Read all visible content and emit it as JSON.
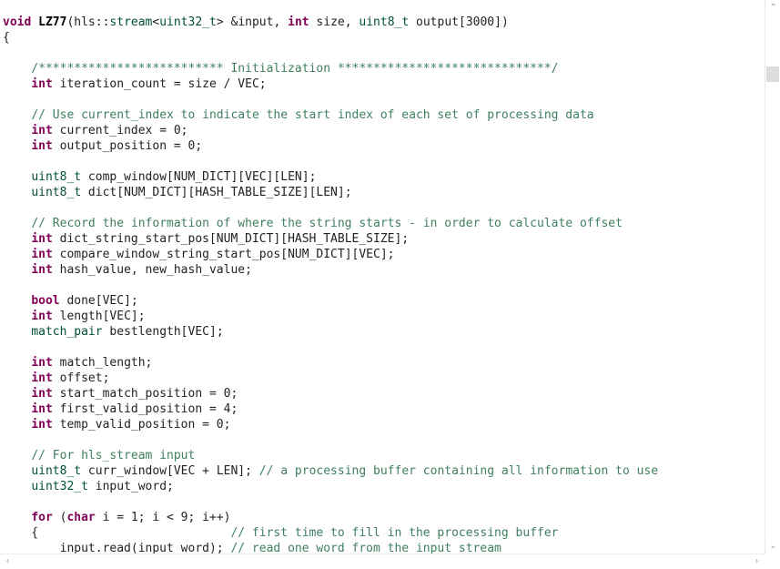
{
  "editor": {
    "lines": [
      [
        {
          "t": "void",
          "c": "kw"
        },
        {
          "t": " "
        },
        {
          "t": "LZ77",
          "c": "fn"
        },
        {
          "t": "(hls::"
        },
        {
          "t": "stream",
          "c": "ty"
        },
        {
          "t": "<"
        },
        {
          "t": "uint32_t",
          "c": "ty"
        },
        {
          "t": "> &input, "
        },
        {
          "t": "int",
          "c": "kw"
        },
        {
          "t": " size, "
        },
        {
          "t": "uint8_t",
          "c": "ty"
        },
        {
          "t": " output[3000])"
        }
      ],
      [
        {
          "t": "{"
        }
      ],
      [],
      [
        {
          "t": "    "
        },
        {
          "t": "/************************** Initialization ******************************/",
          "c": "cm"
        }
      ],
      [
        {
          "t": "    "
        },
        {
          "t": "int",
          "c": "kw"
        },
        {
          "t": " iteration_count = size / VEC;"
        }
      ],
      [],
      [
        {
          "t": "    "
        },
        {
          "t": "// Use current_index to indicate the start index of each set of processing data",
          "c": "cm"
        }
      ],
      [
        {
          "t": "    "
        },
        {
          "t": "int",
          "c": "kw"
        },
        {
          "t": " current_index = 0;"
        }
      ],
      [
        {
          "t": "    "
        },
        {
          "t": "int",
          "c": "kw"
        },
        {
          "t": " output_position = 0;"
        }
      ],
      [],
      [
        {
          "t": "    "
        },
        {
          "t": "uint8_t",
          "c": "ty"
        },
        {
          "t": " comp_window[NUM_DICT][VEC][LEN];"
        }
      ],
      [
        {
          "t": "    "
        },
        {
          "t": "uint8_t",
          "c": "ty"
        },
        {
          "t": " dict[NUM_DICT][HASH_TABLE_SIZE][LEN];"
        }
      ],
      [],
      [
        {
          "t": "    "
        },
        {
          "t": "// Record the information of where the string starts - in order to calculate offset",
          "c": "cm"
        }
      ],
      [
        {
          "t": "    "
        },
        {
          "t": "int",
          "c": "kw"
        },
        {
          "t": " dict_string_start_pos[NUM_DICT][HASH_TABLE_SIZE];"
        }
      ],
      [
        {
          "t": "    "
        },
        {
          "t": "int",
          "c": "kw"
        },
        {
          "t": " compare_window_string_start_pos[NUM_DICT][VEC];"
        }
      ],
      [
        {
          "t": "    "
        },
        {
          "t": "int",
          "c": "kw"
        },
        {
          "t": " hash_value, new_hash_value;"
        }
      ],
      [],
      [
        {
          "t": "    "
        },
        {
          "t": "bool",
          "c": "kw"
        },
        {
          "t": " done[VEC];"
        }
      ],
      [
        {
          "t": "    "
        },
        {
          "t": "int",
          "c": "kw"
        },
        {
          "t": " length[VEC];"
        }
      ],
      [
        {
          "t": "    "
        },
        {
          "t": "match_pair",
          "c": "ty"
        },
        {
          "t": " bestlength[VEC];"
        }
      ],
      [],
      [
        {
          "t": "    "
        },
        {
          "t": "int",
          "c": "kw"
        },
        {
          "t": " match_length;"
        }
      ],
      [
        {
          "t": "    "
        },
        {
          "t": "int",
          "c": "kw"
        },
        {
          "t": " offset;"
        }
      ],
      [
        {
          "t": "    "
        },
        {
          "t": "int",
          "c": "kw"
        },
        {
          "t": " start_match_position = 0;"
        }
      ],
      [
        {
          "t": "    "
        },
        {
          "t": "int",
          "c": "kw"
        },
        {
          "t": " first_valid_position = 4;"
        }
      ],
      [
        {
          "t": "    "
        },
        {
          "t": "int",
          "c": "kw"
        },
        {
          "t": " temp_valid_position = 0;"
        }
      ],
      [],
      [
        {
          "t": "    "
        },
        {
          "t": "// For hls_stream input",
          "c": "cm"
        }
      ],
      [
        {
          "t": "    "
        },
        {
          "t": "uint8_t",
          "c": "ty"
        },
        {
          "t": " curr_window[VEC + LEN]; "
        },
        {
          "t": "// a processing buffer containing all information to use",
          "c": "cm"
        }
      ],
      [
        {
          "t": "    "
        },
        {
          "t": "uint32_t",
          "c": "ty"
        },
        {
          "t": " input_word;"
        }
      ],
      [],
      [
        {
          "t": "    "
        },
        {
          "t": "for",
          "c": "kw"
        },
        {
          "t": " ("
        },
        {
          "t": "char",
          "c": "kw"
        },
        {
          "t": " i = 1; i < 9; i++)"
        }
      ],
      [
        {
          "t": "    {                           "
        },
        {
          "t": "// first time to fill in the processing buffer",
          "c": "cm"
        }
      ],
      [
        {
          "t": "        input.read(input_word); "
        },
        {
          "t": "// read one word from the input stream",
          "c": "cm"
        }
      ]
    ]
  },
  "scrollbars": {
    "up_arrow": "⌃",
    "down_arrow": "⌄",
    "left_arrow": "‹",
    "right_arrow": "›"
  }
}
